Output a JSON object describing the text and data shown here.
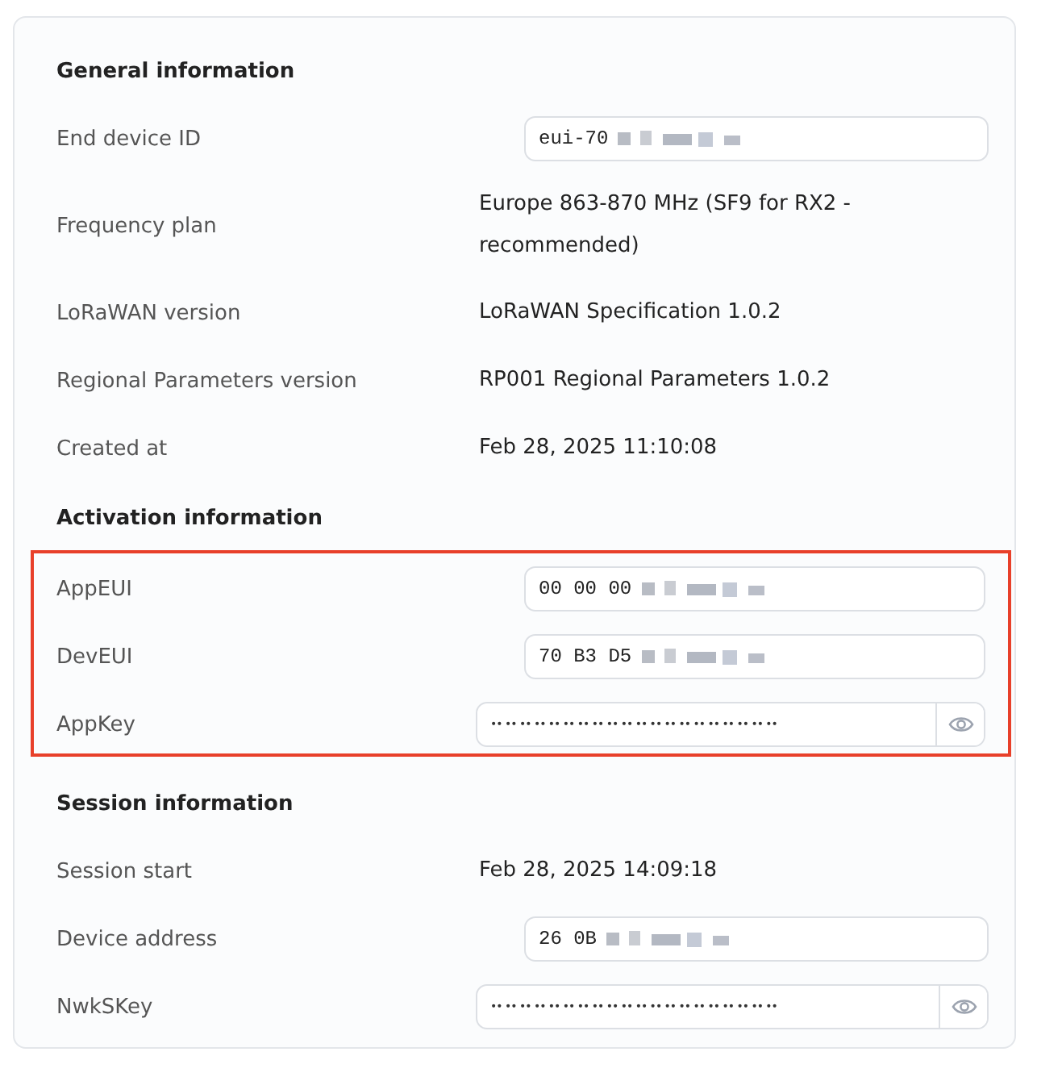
{
  "sections": [
    {
      "title": "General information",
      "highlighted": false,
      "rows": [
        {
          "label": "End device ID",
          "kind": "input",
          "value": "eui-70",
          "redacted": true
        },
        {
          "label": "Frequency plan",
          "kind": "text",
          "value": "Europe 863-870 MHz (SF9 for RX2 - recommended)"
        },
        {
          "label": "LoRaWAN version",
          "kind": "text",
          "value": "LoRaWAN Specification 1.0.2"
        },
        {
          "label": "Regional Parameters version",
          "kind": "text",
          "value": "RP001 Regional Parameters 1.0.2"
        },
        {
          "label": "Created at",
          "kind": "text",
          "value": "Feb 28, 2025 11:10:08"
        }
      ]
    },
    {
      "title": "Activation information",
      "highlighted": true,
      "rows": [
        {
          "label": "AppEUI",
          "kind": "input",
          "value": "00 00 00",
          "redacted": true
        },
        {
          "label": "DevEUI",
          "kind": "input",
          "value": "70 B3 D5",
          "redacted": true
        },
        {
          "label": "AppKey",
          "kind": "secret",
          "value": "•• •• •• •• •• •• •• •• •• •• •• •• •• •• •• •• •• •• •• ••"
        }
      ]
    },
    {
      "title": "Session information",
      "highlighted": false,
      "rows": [
        {
          "label": "Session start",
          "kind": "text",
          "value": "Feb 28, 2025 14:09:18"
        },
        {
          "label": "Device address",
          "kind": "input",
          "value": "26 0B",
          "redacted": true
        },
        {
          "label": "NwkSKey",
          "kind": "secret",
          "value": "•• •• •• •• •• •• •• •• •• •• •• •• •• •• •• •• •• •• •• ••"
        }
      ]
    }
  ]
}
